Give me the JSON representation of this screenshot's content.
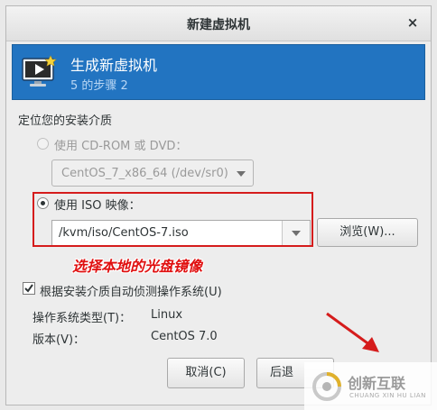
{
  "window": {
    "title": "新建虚拟机",
    "close_glyph": "×"
  },
  "banner": {
    "title": "生成新虚拟机",
    "step": "5 的步骤 2"
  },
  "media": {
    "section_label": "定位您的安装介质",
    "cdrom_label": "使用  CD-ROM 或  DVD：",
    "cdrom_device": "CentOS_7_x86_64 (/dev/sr0)",
    "iso_label": "使用  ISO 映像：",
    "iso_path": "/kvm/iso/CentOS-7.iso",
    "browse_label": "浏览(W)..."
  },
  "annotation": {
    "text": "选择本地的光盘镜像",
    "color": "#e01010"
  },
  "detect": {
    "checkbox_label": "根据安装介质自动侦测操作系统(U)",
    "checked": true,
    "os_type_label": "操作系统类型(T)：",
    "os_type_value": "Linux",
    "version_label": "版本(V)：",
    "version_value": "CentOS 7.0"
  },
  "buttons": {
    "cancel": "取消(C)",
    "back": "后退"
  },
  "watermark": {
    "brand": "创新互联",
    "sub": "CHUANG XIN HU LIAN"
  },
  "colors": {
    "banner": "#2274c1",
    "highlight": "#d51c1c"
  }
}
